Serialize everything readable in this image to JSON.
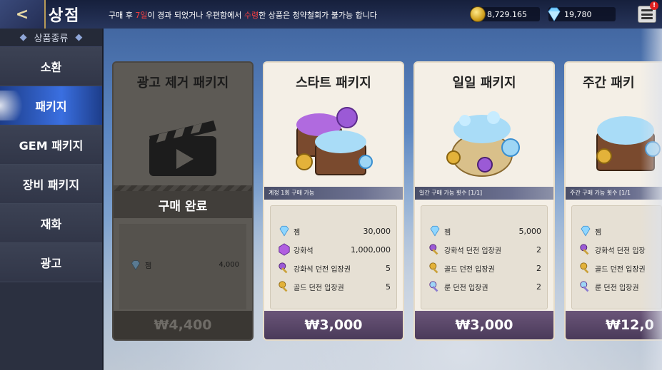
{
  "header": {
    "back_label": "<",
    "title": "상점",
    "notice_prefix": "구매 후 ",
    "notice_days": "7일",
    "notice_mid": "이 경과 되었거나 우편함에서 ",
    "notice_received": "수령",
    "notice_suffix": "한 상품은 청약철회가 불가능 합니다",
    "gold": "8,729.165",
    "gems": "19,780",
    "menu_badge": "!"
  },
  "sidebar": {
    "header": "상품종류",
    "items": [
      {
        "label": "소환"
      },
      {
        "label": "패키지"
      },
      {
        "label": "GEM 패키지"
      },
      {
        "label": "장비 패키지"
      },
      {
        "label": "재화"
      },
      {
        "label": "광고"
      }
    ],
    "active_index": 1
  },
  "cards": [
    {
      "title": "광고 제거 패키지",
      "status": "구매 완료",
      "items": [
        {
          "name": "젬",
          "qty": "4,000"
        }
      ],
      "price": "₩4,400"
    },
    {
      "title": "스타트 패키지",
      "limit": "계정 1회 구매 가능",
      "items": [
        {
          "name": "젬",
          "qty": "30,000"
        },
        {
          "name": "강화석",
          "qty": "1,000,000"
        },
        {
          "name": "강화석 던전 입장권",
          "qty": "5"
        },
        {
          "name": "골드 던전 입장권",
          "qty": "5"
        }
      ],
      "price": "₩3,000"
    },
    {
      "title": "일일 패키지",
      "limit": "일간 구매 가능 횟수 [1/1]",
      "items": [
        {
          "name": "젬",
          "qty": "5,000"
        },
        {
          "name": "강화석 던전 입장권",
          "qty": "2"
        },
        {
          "name": "골드 던전 입장권",
          "qty": "2"
        },
        {
          "name": "룬 던전 입장권",
          "qty": "2"
        }
      ],
      "price": "₩3,000"
    },
    {
      "title": "주간 패키",
      "limit": "주간 구매 가능 횟수 [1/1",
      "items": [
        {
          "name": "젬",
          "qty": ""
        },
        {
          "name": "강화석 던전 입장",
          "qty": ""
        },
        {
          "name": "골드 던전 입장권",
          "qty": ""
        },
        {
          "name": "룬 던전 입장권",
          "qty": ""
        }
      ],
      "price": "₩12,0"
    }
  ],
  "colors": {
    "sidebar_active": "#3a6fe0",
    "price_bar": "#5a4868",
    "notice_red": "#ff4040"
  }
}
